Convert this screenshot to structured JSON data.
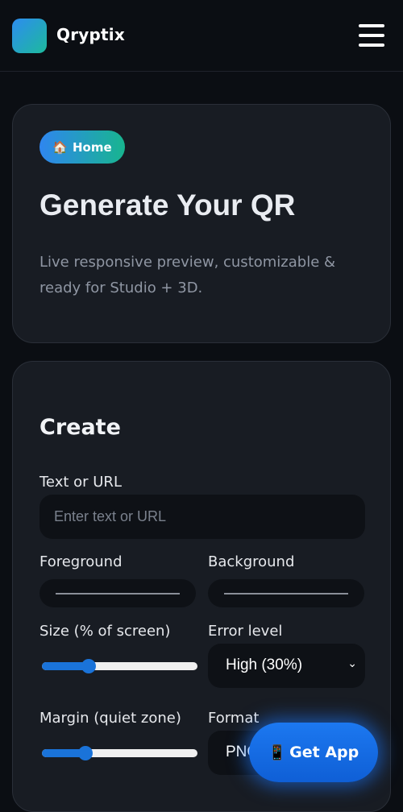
{
  "header": {
    "brand": "Qryptix",
    "logo_gradient": [
      "#2d8cf0",
      "#1dba9c"
    ],
    "menu_icon": "hamburger-menu-icon"
  },
  "hero": {
    "badge_icon": "🏠",
    "badge_label": "Home",
    "title": "Generate Your QR",
    "subtitle": "Live responsive preview, customizable & ready for Studio + 3D."
  },
  "create": {
    "title": "Create",
    "text_label": "Text or URL",
    "text_placeholder": "Enter text or URL",
    "text_value": "",
    "foreground_label": "Foreground",
    "background_label": "Background",
    "size_label": "Size (% of screen)",
    "size_level": 0.3,
    "error_label": "Error level",
    "error_value": "High (30%)",
    "margin_label": "Margin (quiet zone)",
    "margin_level": 0.28,
    "format_label": "Format",
    "format_value": "PNG"
  },
  "fab": {
    "icon": "📱",
    "label": "Get App",
    "accent": "#1c78f0"
  }
}
